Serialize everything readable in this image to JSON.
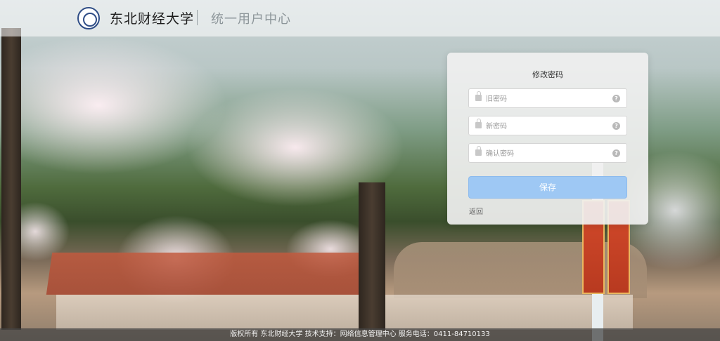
{
  "header": {
    "school_name": "东北财经大学",
    "system_name": "统一用户中心"
  },
  "panel": {
    "title": "修改密码",
    "fields": [
      {
        "placeholder": "旧密码",
        "value": ""
      },
      {
        "placeholder": "新密码",
        "value": ""
      },
      {
        "placeholder": "确认密码",
        "value": ""
      }
    ],
    "save_label": "保存",
    "back_label": "返回"
  },
  "footer": {
    "text": "版权所有 东北财经大学 技术支持：网络信息管理中心 服务电话：0411-84710133"
  },
  "icons": {
    "logo": "university-seal-icon",
    "field_left": "lock-icon",
    "field_right": "question-icon"
  },
  "colors": {
    "save_button": "#9ec8f4",
    "header_bg": "rgba(255,255,255,.55)",
    "footer_bg": "rgba(70,70,70,.75)"
  }
}
